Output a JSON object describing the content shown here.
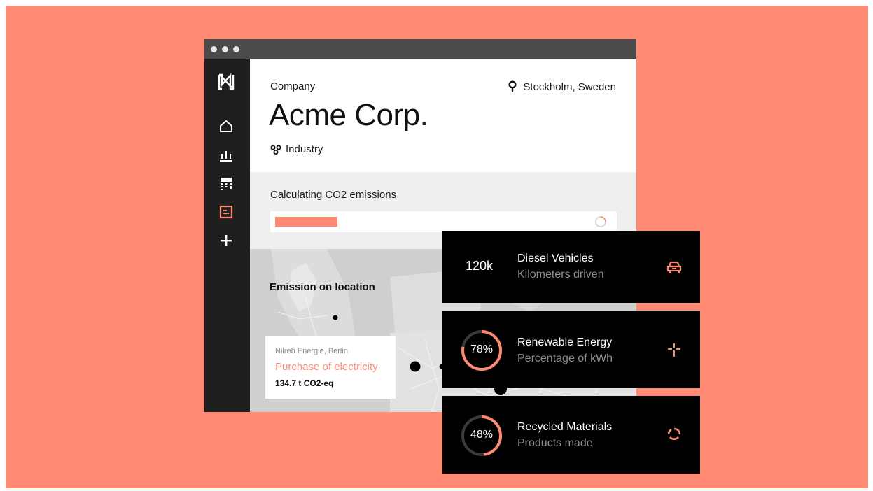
{
  "app": {
    "logo_letter": "N"
  },
  "sidebar": {
    "items": [
      {
        "icon": "home-icon",
        "active": false
      },
      {
        "icon": "bar-chart-icon",
        "active": false
      },
      {
        "icon": "calculator-icon",
        "active": false
      },
      {
        "icon": "report-icon",
        "active": true
      },
      {
        "icon": "plus-icon",
        "active": false
      }
    ]
  },
  "header": {
    "label": "Company",
    "company_name": "Acme Corp.",
    "industry": "Industry",
    "location": "Stockholm, Sweden"
  },
  "calculation": {
    "title": "Calculating CO2 emissions",
    "progress": 0.18
  },
  "map": {
    "title": "Emission on location",
    "popup": {
      "source": "Nilreb Energie, Berlin",
      "title": "Purchase of electricity",
      "value": "134.7 t CO2-eq"
    }
  },
  "cards": [
    {
      "value": "120k",
      "title": "Diesel Vehicles",
      "subtitle": "Kilometers driven",
      "icon": "car-icon"
    },
    {
      "value": "78%",
      "percent": 78,
      "title": "Renewable Energy",
      "subtitle": "Percentage of kWh",
      "icon": "wind-turbine-icon"
    },
    {
      "value": "48%",
      "percent": 48,
      "title": "Recycled Materials",
      "subtitle": "Products made",
      "icon": "recycle-icon"
    }
  ],
  "colors": {
    "accent": "#ff8a73",
    "sidebar": "#1f1f1f",
    "titlebar": "#4a4a4a",
    "card": "#000000"
  }
}
